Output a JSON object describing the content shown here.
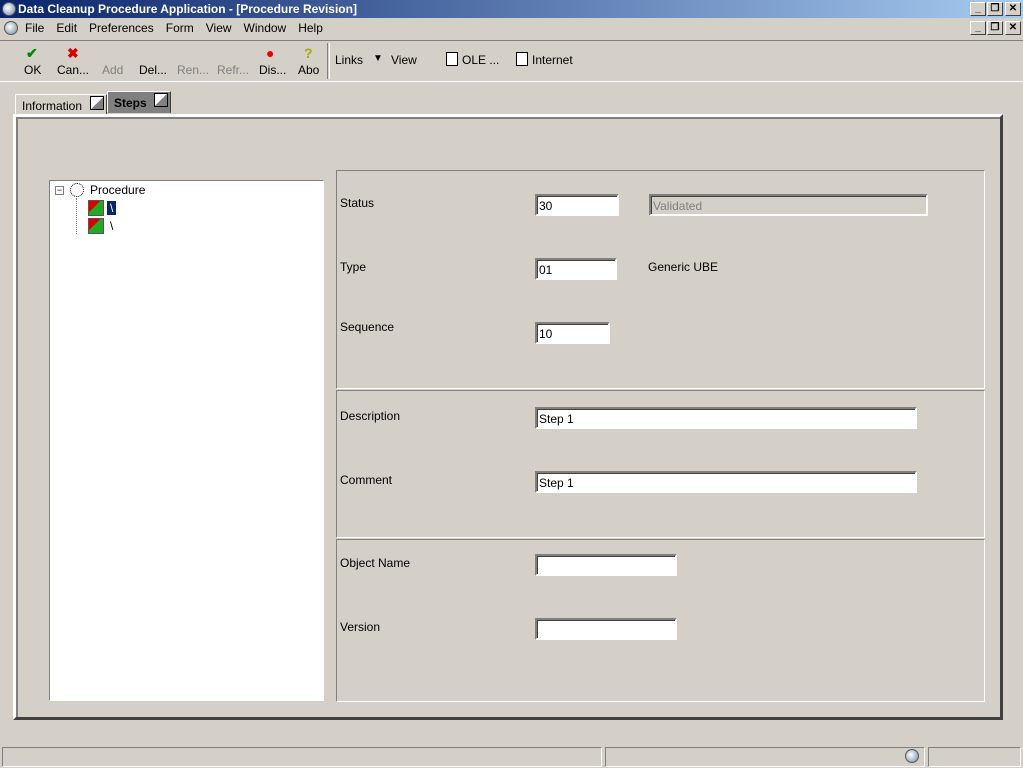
{
  "window": {
    "title": "Data Cleanup Procedure Application - [Procedure Revision]"
  },
  "menu": [
    "File",
    "Edit",
    "Preferences",
    "Form",
    "View",
    "Window",
    "Help"
  ],
  "toolbar": {
    "ok": "OK",
    "cancel": "Can...",
    "add": "Add",
    "delete": "Del...",
    "rename": "Ren...",
    "refresh": "Refr...",
    "display": "Dis...",
    "about": "Abo",
    "links": "Links",
    "view": "View",
    "ole": "OLE ...",
    "internet": "Internet"
  },
  "tabs": {
    "information": "Information",
    "steps": "Steps"
  },
  "tree": {
    "root": "Procedure",
    "children": [
      "\\",
      "\\"
    ]
  },
  "form": {
    "status_label": "Status",
    "status_value": "30",
    "status_desc": "Validated",
    "type_label": "Type",
    "type_value": "01",
    "type_desc": "Generic UBE",
    "sequence_label": "Sequence",
    "sequence_value": "10",
    "description_label": "Description",
    "description_value": "Step 1",
    "comment_label": "Comment",
    "comment_value": "Step 1",
    "object_name_label": "Object Name",
    "object_name_value": "",
    "version_label": "Version",
    "version_value": ""
  }
}
